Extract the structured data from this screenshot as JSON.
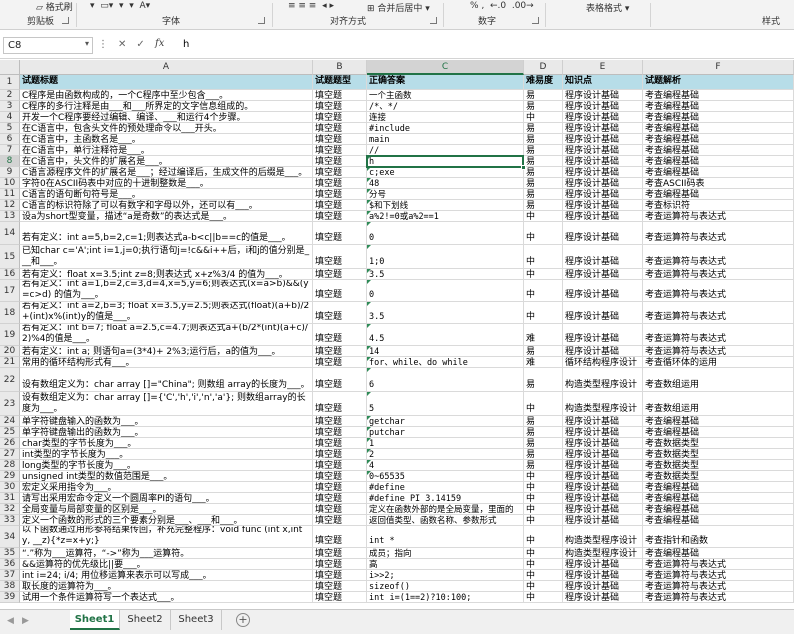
{
  "ribbon": {
    "format_painter": "格式刷",
    "groups": [
      "剪贴板",
      "字体",
      "对齐方式",
      "数字",
      "样式"
    ],
    "table_format": "表格格式",
    "merge_center": "合并后居中"
  },
  "formula_bar": {
    "name_box": "C8",
    "fx_label": "fx",
    "content": "h",
    "cancel_icon": "✕",
    "enter_icon": "✓"
  },
  "columns": [
    "A",
    "B",
    "C",
    "D",
    "E",
    "F"
  ],
  "selected_cell": {
    "row": 8,
    "col": "C"
  },
  "rows": [
    {
      "n": 1,
      "cells": [
        "试题标题",
        "试题题型",
        "正确答案",
        "难易度",
        "知识点",
        "试题解析"
      ]
    },
    {
      "n": 2,
      "cells": [
        "C程序是由函数构成的，一个C程序中至少包含___。",
        "填空题",
        "一个主函数",
        "易",
        "程序设计基础",
        "考查编程基础"
      ]
    },
    {
      "n": 3,
      "cells": [
        "C程序的多行注释是由___和___所界定的文字信息组成的。",
        "填空题",
        "/*、*/",
        "易",
        "程序设计基础",
        "考查编程基础"
      ]
    },
    {
      "n": 4,
      "cells": [
        "开发一个C程序要经过编辑、编译、___和运行4个步骤。",
        "填空题",
        "连接",
        "中",
        "程序设计基础",
        "考查编程基础"
      ]
    },
    {
      "n": 5,
      "cells": [
        "在C语言中，包含头文件的预处理命令以___开头。",
        "填空题",
        "#include",
        "易",
        "程序设计基础",
        "考查编程基础"
      ]
    },
    {
      "n": 6,
      "cells": [
        "在C语言中，主函数名是___。",
        "填空题",
        "main",
        "易",
        "程序设计基础",
        "考查编程基础"
      ]
    },
    {
      "n": 7,
      "cells": [
        "在C语言中，单行注释符是___。",
        "填空题",
        "//",
        "易",
        "程序设计基础",
        "考查编程基础"
      ]
    },
    {
      "n": 8,
      "cells": [
        "在C语言中，头文件的扩展名是___。",
        "填空题",
        "h",
        "易",
        "程序设计基础",
        "考查编程基础"
      ]
    },
    {
      "n": 9,
      "cells": [
        "C语言源程序文件的扩展名是___；经过编译后，生成文件的后缀是___。",
        "填空题",
        "c;exe",
        "易",
        "程序设计基础",
        "考查编程基础"
      ]
    },
    {
      "n": 10,
      "cells": [
        "字符0在ASCII码表中对应的十进制整数是___。",
        "填空题",
        "48",
        "易",
        "程序设计基础",
        "考查ASCII码表"
      ]
    },
    {
      "n": 11,
      "cells": [
        "C语言的语句断句符号是___。",
        "填空题",
        "分号",
        "易",
        "程序设计基础",
        "考查编程基础"
      ]
    },
    {
      "n": 12,
      "cells": [
        "C语言的标识符除了可以有数字和字母以外，还可以有___。",
        "填空题",
        "$和下划线",
        "易",
        "程序设计基础",
        "考查标识符"
      ]
    },
    {
      "n": 13,
      "cells": [
        "设a为short型变量，描述“a是奇数”的表达式是___。",
        "填空题",
        "a%2!=0或a%2==1",
        "中",
        "程序设计基础",
        "考查运算符与表达式"
      ]
    },
    {
      "n": 14,
      "cells": [
        "若有定义：int a=5,b=2,c=1;则表达式a-b<c||b==c的值是___。",
        "填空题",
        "0",
        "中",
        "程序设计基础",
        "考查运算符与表达式"
      ]
    },
    {
      "n": 15,
      "cells": [
        "已知char c='A';int i=1,j=0;执行语句j=!c&&i++后，i和j的值分别是___和___。",
        "填空题",
        "1;0",
        "中",
        "程序设计基础",
        "考查运算符与表达式"
      ]
    },
    {
      "n": 16,
      "cells": [
        "若有定义：float x=3.5;int z=8;则表达式 x+z%3/4 的值为___。",
        "填空题",
        "3.5",
        "中",
        "程序设计基础",
        "考查运算符与表达式"
      ]
    },
    {
      "n": 17,
      "cells": [
        "若有定义：int a=1,b=2,c=3,d=4,x=5,y=6;则表达式(x=a>b)&&(y=c>d) 的值为___。",
        "填空题",
        "0",
        "中",
        "程序设计基础",
        "考查运算符与表达式"
      ]
    },
    {
      "n": 18,
      "cells": [
        "若有定义：int a=2,b=3; float x=3.5,y=2.5;则表达式(float)(a+b)/2+(int)x%(int)y的值是___。",
        "填空题",
        "3.5",
        "中",
        "程序设计基础",
        "考查运算符与表达式"
      ]
    },
    {
      "n": 19,
      "cells": [
        "若有定义：int b=7; float a=2.5,c=4.7;则表达式a+(b/2*(int)(a+c)/2)%4的值是___。",
        "填空题",
        "4.5",
        "难",
        "程序设计基础",
        "考查运算符与表达式"
      ]
    },
    {
      "n": 20,
      "cells": [
        "若有定义：int a; 则语句a=(3*4)+ 2%3;运行后，a的值为___。",
        "填空题",
        "14",
        "易",
        "程序设计基础",
        "考查运算符与表达式"
      ]
    },
    {
      "n": 21,
      "cells": [
        "常用的循环结构形式有___。",
        "填空题",
        "for、while、do while",
        "难",
        "循环结构程序设计",
        "考查循环体的运用"
      ]
    },
    {
      "n": 22,
      "cells": [
        "设有数组定义为：char array []=\"China\"; 则数组 array的长度为___。",
        "填空题",
        "6",
        "易",
        "构造类型程序设计",
        "考查数组运用"
      ]
    },
    {
      "n": 23,
      "cells": [
        "设有数组定义为：char array []={'C','h','i','n','a'}; 则数组array的长度为___。",
        "填空题",
        "5",
        "中",
        "构造类型程序设计",
        "考查数组运用"
      ]
    },
    {
      "n": 24,
      "cells": [
        "单字符键盘输入的函数为___。",
        "填空题",
        "getchar",
        "易",
        "程序设计基础",
        "考查编程基础"
      ]
    },
    {
      "n": 25,
      "cells": [
        "单字符键盘输出的函数为___。",
        "填空题",
        "putchar",
        "易",
        "程序设计基础",
        "考查编程基础"
      ]
    },
    {
      "n": 26,
      "cells": [
        "char类型的字节长度为___。",
        "填空题",
        "1",
        "易",
        "程序设计基础",
        "考查数据类型"
      ]
    },
    {
      "n": 27,
      "cells": [
        "int类型的字节长度为___。",
        "填空题",
        "2",
        "易",
        "程序设计基础",
        "考查数据类型"
      ]
    },
    {
      "n": 28,
      "cells": [
        "long类型的字节长度为___。",
        "填空题",
        "4",
        "易",
        "程序设计基础",
        "考查数据类型"
      ]
    },
    {
      "n": 29,
      "cells": [
        "unsigned int类型的数值范围是___。",
        "填空题",
        "0~65535",
        "中",
        "程序设计基础",
        "考查数据类型"
      ]
    },
    {
      "n": 30,
      "cells": [
        "宏定义采用指令为___。",
        "填空题",
        "#define",
        "中",
        "程序设计基础",
        "考查编程基础"
      ]
    },
    {
      "n": 31,
      "cells": [
        "请写出采用宏命令定义一个圆周率PI的语句___。",
        "填空题",
        "#define PI 3.14159",
        "中",
        "程序设计基础",
        "考查编程基础"
      ]
    },
    {
      "n": 32,
      "cells": [
        "全局变量与局部变量的区别是___。",
        "填空题",
        "定义在函数外部的是全局变量，里面的",
        "中",
        "程序设计基础",
        "考查编程基础"
      ]
    },
    {
      "n": 33,
      "cells": [
        "定义一个函数的形式的三个要素分别是___、___和___。",
        "填空题",
        "返回值类型、函数名称、参数形式",
        "中",
        "程序设计基础",
        "考查编程基础"
      ]
    },
    {
      "n": 34,
      "cells": [
        "以下函数通过用形参将结果传回，补充完整程序：void func (int x,int y, __z){*z=x+y;}",
        "填空题",
        "int *",
        "中",
        "构造类型程序设计",
        "考查指针和函数"
      ]
    },
    {
      "n": 35,
      "cells": [
        "“.”称为___运算符，“->”称为___运算符。",
        "填空题",
        "成员；指向",
        "中",
        "构造类型程序设计",
        "考查编程基础"
      ]
    },
    {
      "n": 36,
      "cells": [
        "&&运算符的优先级比||要___。",
        "填空题",
        "高",
        "中",
        "程序设计基础",
        "考查运算符与表达式"
      ]
    },
    {
      "n": 37,
      "cells": [
        "int i=24; i/4; 用位移运算来表示可以写成___。",
        "填空题",
        "i>>2;",
        "中",
        "程序设计基础",
        "考查运算符与表达式"
      ]
    },
    {
      "n": 38,
      "cells": [
        "取长度的运算符为___。",
        "填空题",
        "sizeof()",
        "中",
        "程序设计基础",
        "考查运算符与表达式"
      ]
    },
    {
      "n": 39,
      "cells": [
        "试用一个条件运算符写一个表达式___。",
        "填空题",
        "int i=(1==2)?10:100;",
        "中",
        "程序设计基础",
        "考查运算符与表达式"
      ]
    }
  ],
  "sheets": [
    "Sheet1",
    "Sheet2",
    "Sheet3"
  ],
  "active_sheet": "Sheet1",
  "colors": {
    "header_fill": "#b7dde8",
    "accent": "#217346",
    "comment_marker": "#2e8b57"
  }
}
